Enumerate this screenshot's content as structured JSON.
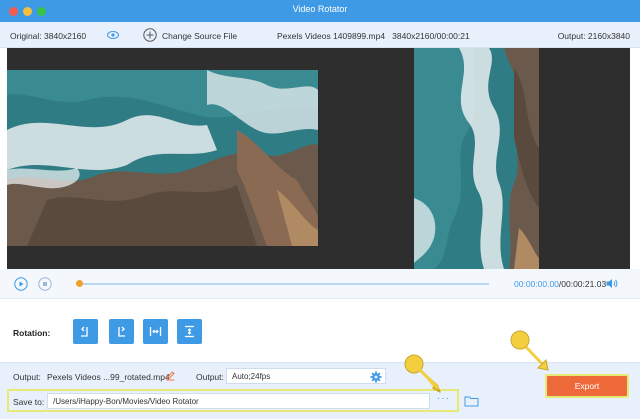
{
  "window": {
    "title": "Video Rotator"
  },
  "infobar": {
    "original": "Original: 3840x2160",
    "change_source": "Change Source File",
    "filename": "Pexels Videos 1409899.mp4",
    "file_info": "3840x2160/00:00:21",
    "output": "Output: 2160x3840"
  },
  "playback": {
    "current_time": "00:00:00.00",
    "total_time": "/00:00:21.03",
    "progress": 0
  },
  "rotation": {
    "label": "Rotation:",
    "buttons": [
      "rotate-left",
      "rotate-right",
      "flip-horizontal",
      "flip-vertical"
    ]
  },
  "output": {
    "label": "Output:",
    "filename": "Pexels Videos ...99_rotated.mp4",
    "format_label": "Output:",
    "format_value": "Auto;24fps"
  },
  "save": {
    "label": "Save to:",
    "path": "/Users/iHappy-Bon/Movies/Video Rotator",
    "browse": "···"
  },
  "export": {
    "label": "Export"
  },
  "colors": {
    "accent": "#3f9ae6",
    "export": "#ef6a3a",
    "highlight": "#e6ea75",
    "pointer": "#f3cf3f"
  }
}
